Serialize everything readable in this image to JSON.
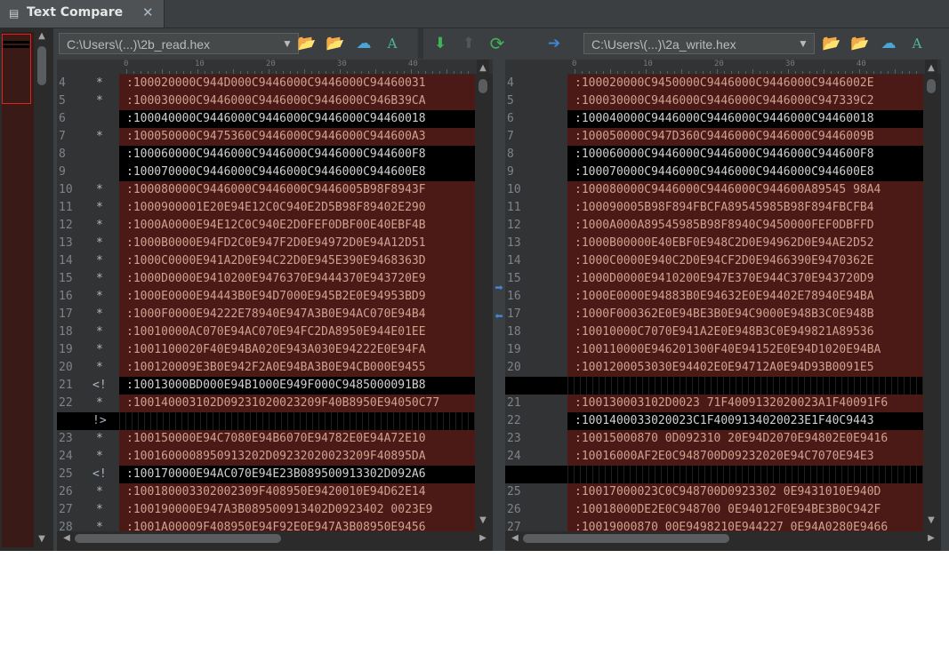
{
  "tab": {
    "title": "Text Compare",
    "icon": "text-compare-icon",
    "close": "✕"
  },
  "left": {
    "path": "C:\\Users\\(...)\\2b_read.hex",
    "ruler": [
      "0",
      "10",
      "20",
      "30",
      "40"
    ],
    "rows": [
      {
        "n": "4",
        "m": "*",
        "t": ":100020000C944D000C9446000C9446000C94460031",
        "k": "diff"
      },
      {
        "n": "5",
        "m": "*",
        "t": ":100030000C9446000C9446000C9446000C946B39CA",
        "k": "diff"
      },
      {
        "n": "6",
        "m": "",
        "t": ":100040000C9446000C9446000C9446000C94460018",
        "k": "same"
      },
      {
        "n": "7",
        "m": "*",
        "t": ":100050000C9475360C9446000C9446000C944600A3",
        "k": "diff"
      },
      {
        "n": "8",
        "m": "",
        "t": ":100060000C9446000C9446000C9446000C944600F8",
        "k": "same"
      },
      {
        "n": "9",
        "m": "",
        "t": ":100070000C9446000C9446000C9446000C944600E8",
        "k": "same"
      },
      {
        "n": "10",
        "m": "*",
        "t": ":100080000C9446000C9446000C9446005B98F8943F",
        "k": "diff"
      },
      {
        "n": "11",
        "m": "*",
        "t": ":1000900001E20E94E12C0C940E2D5B98F89402E290",
        "k": "diff"
      },
      {
        "n": "12",
        "m": "*",
        "t": ":1000A0000E94E12C0C940E2D0FEF0DBF00E40EBF4B",
        "k": "diff"
      },
      {
        "n": "13",
        "m": "*",
        "t": ":1000B0000E94FD2C0E947F2D0E94972D0E94A12D51",
        "k": "diff"
      },
      {
        "n": "14",
        "m": "*",
        "t": ":1000C0000E941A2D0E94C22D0E945E390E9468363D",
        "k": "diff"
      },
      {
        "n": "15",
        "m": "*",
        "t": ":1000D0000E9410200E9476370E9444370E943720E9",
        "k": "diff"
      },
      {
        "n": "16",
        "m": "*",
        "t": ":1000E0000E94443B0E94D7000E945B2E0E94953BD9",
        "k": "diff"
      },
      {
        "n": "17",
        "m": "*",
        "t": ":1000F0000E94222E78940E947A3B0E94AC070E94B4",
        "k": "diff"
      },
      {
        "n": "18",
        "m": "*",
        "t": ":10010000AC070E94AC070E94FC2DA8950E944E01EE",
        "k": "diff"
      },
      {
        "n": "19",
        "m": "*",
        "t": ":1001100020F40E94BA020E943A030E94222E0E94FA",
        "k": "diff"
      },
      {
        "n": "20",
        "m": "*",
        "t": ":100120009E3B0E942F2A0E94BA3B0E94CB000E9455",
        "k": "diff"
      },
      {
        "n": "21",
        "m": "<!",
        "t": ":10013000BD000E94B1000E949F000C9485000091B8",
        "k": "same"
      },
      {
        "n": "22",
        "m": "*",
        "t": ":100140003102D09231020023209F40B8950E94050C77",
        "k": "diff"
      },
      {
        "n": "",
        "m": "!>",
        "t": "",
        "k": "gap"
      },
      {
        "n": "23",
        "m": "*",
        "t": ":100150000E94C7080E94B6070E94782E0E94A72E10",
        "k": "diff"
      },
      {
        "n": "24",
        "m": "*",
        "t": ":1001600008950913202D09232020023209F40895DA",
        "k": "diff"
      },
      {
        "n": "25",
        "m": "<!",
        "t": ":100170000E94AC070E94E23B089500913302D092A6",
        "k": "same"
      },
      {
        "n": "26",
        "m": "*",
        "t": ":100180003302002309F408950E9420010E94D62E14",
        "k": "diff"
      },
      {
        "n": "27",
        "m": "*",
        "t": ":100190000E947A3B089500913402D0923402 0023E9",
        "k": "diff"
      },
      {
        "n": "28",
        "m": "*",
        "t": ":1001A00009F408950E94F92E0E947A3B08950E9456",
        "k": "diff"
      }
    ]
  },
  "right": {
    "path": "C:\\Users\\(...)\\2a_write.hex",
    "ruler": [
      "0",
      "10",
      "20",
      "30",
      "40"
    ],
    "rows": [
      {
        "n": "4",
        "t": ":100020000C9450000C9446000C9446000C9446002E",
        "k": "diff"
      },
      {
        "n": "5",
        "t": ":100030000C9446000C9446000C9446000C947339C2",
        "k": "diff"
      },
      {
        "n": "6",
        "t": ":100040000C9446000C9446000C9446000C94460018",
        "k": "same"
      },
      {
        "n": "7",
        "t": ":100050000C947D360C9446000C9446000C9446009B",
        "k": "diff"
      },
      {
        "n": "8",
        "t": ":100060000C9446000C9446000C9446000C944600F8",
        "k": "same"
      },
      {
        "n": "9",
        "t": ":100070000C9446000C9446000C9446000C944600E8",
        "k": "same"
      },
      {
        "n": "10",
        "t": ":100080000C9446000C9446000C944600A89545 98A4",
        "k": "diff"
      },
      {
        "n": "11",
        "t": ":100090005B98F894FBCFA89545985B98F894FBCFB4",
        "k": "diff"
      },
      {
        "n": "12",
        "t": ":1000A000A89545985B98F8940C9450000FEF0DBFFD",
        "k": "diff"
      },
      {
        "n": "13",
        "t": ":1000B00000E40EBF0E948C2D0E94962D0E94AE2D52",
        "k": "diff"
      },
      {
        "n": "14",
        "t": ":1000C0000E940C2D0E94CF2D0E9466390E9470362E",
        "k": "diff"
      },
      {
        "n": "15",
        "t": ":1000D0000E9410200E947E370E944C370E943720D9",
        "k": "diff"
      },
      {
        "n": "16",
        "t": ":1000E0000E94883B0E94632E0E94402E78940E94BA",
        "k": "diff"
      },
      {
        "n": "17",
        "t": ":1000F000362E0E94BE3B0E94C9000E948B3C0E948B",
        "k": "diff"
      },
      {
        "n": "18",
        "t": ":10010000C7070E941A2E0E948B3C0E949821A89536",
        "k": "diff"
      },
      {
        "n": "19",
        "t": ":100110000E946201300F40E94152E0E94D1020E94BA",
        "k": "diff"
      },
      {
        "n": "20",
        "t": ":1001200053030E94402E0E94712A0E94D93B0091E5",
        "k": "diff"
      },
      {
        "n": "",
        "t": "",
        "k": "gap"
      },
      {
        "n": "21",
        "t": ":100130003102D0023 71F4009132020023A1F40091F6",
        "k": "diff"
      },
      {
        "n": "22",
        "t": ":1001400033020023C1F4009134020023E1F40C9443",
        "k": "same"
      },
      {
        "n": "23",
        "t": ":10015000870 0D092310 20E94D2070E94802E0E9416",
        "k": "diff"
      },
      {
        "n": "24",
        "t": ":10016000AF2E0C948700D09232020E94C7070E94E3",
        "k": "diff"
      },
      {
        "n": "",
        "t": "",
        "k": "gap"
      },
      {
        "n": "25",
        "t": ":10017000023C0C948700D0923302 0E9431010E940D",
        "k": "diff"
      },
      {
        "n": "26",
        "t": ":10018000DE2E0C948700 0E94012F0E94BE3B0C942F",
        "k": "diff"
      },
      {
        "n": "27",
        "t": ":10019000870 00E9498210E944227 0E94A0280E9466",
        "k": "diff"
      }
    ]
  },
  "icons": {
    "open_folder": "folder-open-icon",
    "recent_folder": "folder-recent-icon",
    "cloud": "cloud-upload-icon",
    "font": "font-icon",
    "next_diff": "arrow-down-icon",
    "prev_diff": "arrow-up-icon",
    "refresh": "refresh-icon",
    "swap_left": "arrow-left-icon",
    "swap_right": "arrow-right-icon"
  },
  "glyphs": {
    "drop": "▼",
    "up": "▲",
    "down": "▼",
    "left": "◀",
    "right": "▶",
    "a": "A",
    "folder": "📂",
    "cloud": "☁",
    "arrow_down": "⬇",
    "arrow_up": "⬆",
    "refresh": "⟳",
    "arrow_right": "➔",
    "small_right": "➡",
    "small_left": "⬅"
  }
}
